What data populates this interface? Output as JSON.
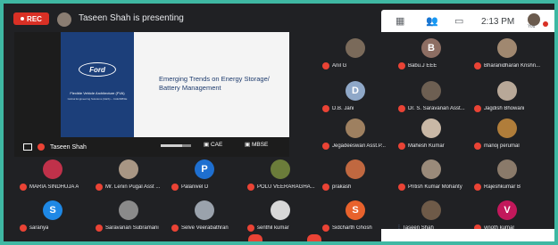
{
  "topbar": {
    "rec_label": "REC",
    "presenting_text": "Taseen Shah is presenting",
    "clock": "2:13 PM",
    "you_label": "You"
  },
  "slide": {
    "logo": "Ford",
    "left_title": "Flexible Vehicle Architecture (FVA)",
    "left_subtitle": "Global Engineering Solutions (GES) – CAE/MBSE",
    "heading_line1": "Emerging Trends on Energy Storage/",
    "heading_line2": "Battery Management",
    "footer_cae": "CAE",
    "footer_mbse": "MBSE",
    "presenter_label": "Taseen Shah"
  },
  "colors": {
    "frame_border": "#3fb8a3",
    "background": "#202124",
    "mic_muted": "#ea4335",
    "slide_blue": "#1c3f7a"
  },
  "participants": [
    {
      "name": "Anil G",
      "initial": "",
      "color": "#7a6a5a"
    },
    {
      "name": "Babu.J  EEE",
      "initial": "B",
      "color": "#8d6e63"
    },
    {
      "name": "Bharanidharan Krishn...",
      "initial": "",
      "color": "#a08870"
    },
    {
      "name": "D.B. Jani",
      "initial": "D",
      "color": "#8fa8c8"
    },
    {
      "name": "Dr. S. Saravanan Asst...",
      "initial": "",
      "color": "#6d5f52"
    },
    {
      "name": "Jagdish Bhowani",
      "initial": "",
      "color": "#b8a898"
    },
    {
      "name": "Jegadeeswari Asst.P...",
      "initial": "",
      "color": "#9e8060"
    },
    {
      "name": "Mahesh Kumar",
      "initial": "",
      "color": "#c9b8a6"
    },
    {
      "name": "manoj perumal",
      "initial": "",
      "color": "#b07d3a"
    },
    {
      "name": "MARIA SINDHUJA A",
      "initial": "",
      "color": "#c0314a"
    },
    {
      "name": "Mr. Lenin Pugal Asst ...",
      "initial": "",
      "color": "#a89684"
    },
    {
      "name": "Palanivel D",
      "initial": "P",
      "color": "#1e6fd0"
    },
    {
      "name": "POLU VEERARAGHA...",
      "initial": "",
      "color": "#6b7c3a"
    },
    {
      "name": "prakash",
      "initial": "",
      "color": "#c06840"
    },
    {
      "name": "Pritish Kumar Mohanty",
      "initial": "",
      "color": "#9a8a7a"
    },
    {
      "name": "Rajeshkumar B",
      "initial": "",
      "color": "#8a7a6a"
    },
    {
      "name": "saranya",
      "initial": "S",
      "color": "#1e88e5"
    },
    {
      "name": "Saravanan Subramani",
      "initial": "",
      "color": "#8a8a8a"
    },
    {
      "name": "Selve Veerabathran",
      "initial": "",
      "color": "#9aa2ac"
    },
    {
      "name": "senthil kumar",
      "initial": "",
      "color": "#d8d8d8"
    },
    {
      "name": "Sidcharth Ghosh",
      "initial": "S",
      "color": "#e8622c"
    },
    {
      "name": "Taseen Shah",
      "initial": "",
      "color": "#6e5a48"
    },
    {
      "name": "vinoth kumar",
      "initial": "V",
      "color": "#c2185b"
    }
  ]
}
